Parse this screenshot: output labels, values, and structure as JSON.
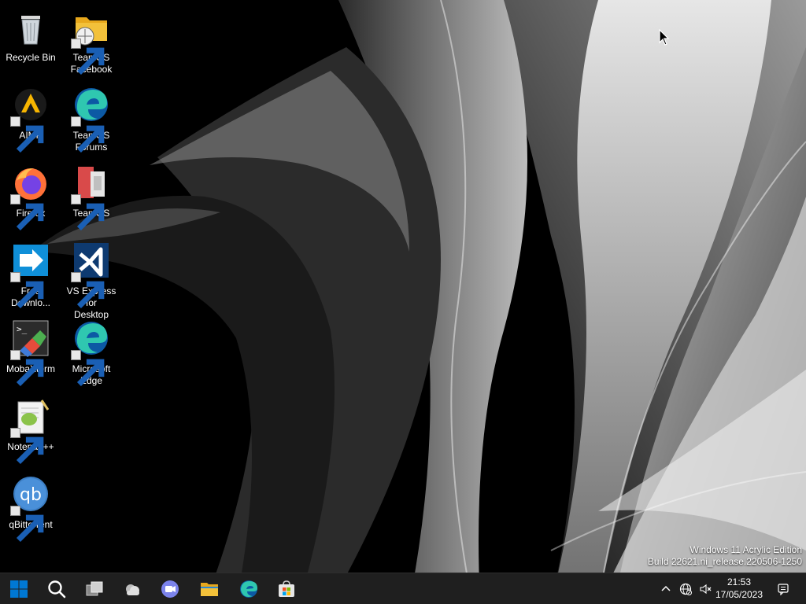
{
  "desktop": {
    "icons": [
      {
        "id": "recycle-bin",
        "label": "Recycle Bin"
      },
      {
        "id": "teamos-facebook",
        "label": "TeamOS\nFacebook"
      },
      {
        "id": "aimp",
        "label": "AIMP"
      },
      {
        "id": "teamos-forums",
        "label": "TeamOS\nForums"
      },
      {
        "id": "firefox",
        "label": "Firefox"
      },
      {
        "id": "teamos",
        "label": "TeamOS"
      },
      {
        "id": "free-download",
        "label": "Free\nDownlo..."
      },
      {
        "id": "vs-express",
        "label": "VS Express for\nDesktop"
      },
      {
        "id": "mobaxterm",
        "label": "MobaXterm"
      },
      {
        "id": "microsoft-edge",
        "label": "Microsoft\nEdge"
      },
      {
        "id": "notepad-plus-plus",
        "label": "Notepad++"
      },
      {
        "id": "qbittorrent",
        "label": "qBittorrent"
      }
    ]
  },
  "watermark": {
    "line1": "Windows 11 Acrylic Edition",
    "line2": "Build 22621.ni_release.220506-1250"
  },
  "taskbar": {
    "buttons": [
      {
        "id": "start",
        "icon": "windows-logo-icon"
      },
      {
        "id": "search",
        "icon": "search-icon"
      },
      {
        "id": "task-view",
        "icon": "task-view-icon"
      },
      {
        "id": "widgets",
        "icon": "weather-cloud-icon"
      },
      {
        "id": "chat",
        "icon": "teams-chat-icon"
      },
      {
        "id": "file-explorer",
        "icon": "folder-icon"
      },
      {
        "id": "edge",
        "icon": "edge-icon"
      },
      {
        "id": "store",
        "icon": "store-icon"
      }
    ],
    "tray": {
      "overflow_icon": "chevron-up-icon",
      "network_icon": "globe-network-icon",
      "volume_icon": "speaker-muted-icon",
      "time": "21:53",
      "date": "17/05/2023",
      "notification_icon": "notification-icon"
    }
  },
  "colors": {
    "taskbar_bg": "#1f1f1f",
    "windows_blue": "#0078d4",
    "folder_yellow": "#f3c13a",
    "edge_teal": "#2fc7b0"
  }
}
